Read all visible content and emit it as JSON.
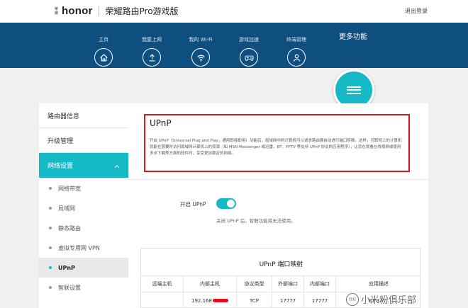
{
  "header": {
    "brand_small": "荣耀",
    "brand": "honor",
    "product": "荣耀路由Pro游戏版",
    "logout": "退出登录"
  },
  "nav": {
    "items": [
      {
        "label": "主页",
        "icon": "home-icon"
      },
      {
        "label": "我要上网",
        "icon": "upload-icon"
      },
      {
        "label": "我的 Wi-Fi",
        "icon": "wifi-icon"
      },
      {
        "label": "游戏加速",
        "icon": "gamepad-icon"
      },
      {
        "label": "终端管理",
        "icon": "user-icon"
      }
    ],
    "more": {
      "label": "更多功能",
      "icon": "menu-icon"
    }
  },
  "sidebar": {
    "items": [
      {
        "label": "路由器信息"
      },
      {
        "label": "升级管理"
      },
      {
        "label": "网络设置"
      }
    ],
    "sub_items": [
      {
        "label": "网络带宽"
      },
      {
        "label": "局域网"
      },
      {
        "label": "静态路由"
      },
      {
        "label": "虚拟专用网 VPN"
      },
      {
        "label": "UPnP"
      },
      {
        "label": "智联设置"
      }
    ]
  },
  "upnp": {
    "title": "UPnP",
    "description": "开启 UPnP（Universal Plug and Play，通用即插即用）功能后，局域网中的计算机可以请求路由器自动进行端口转换。这样，互联网上的计算机就能在需要时访问局域网计算机上的资源（如 MSN Messenger 或迅雷、BT、PPTV 等支持 UPnP 协议的应用程序），让您在观看在线视频或使用多点下载等方面的软件时，享受更加稳定的网络。",
    "toggle_label": "开启 UPnP",
    "toggle_on": true,
    "toggle_hint": "关闭 UPnP 后，智联功能将无法使用。"
  },
  "port_map": {
    "title": "UPnP 端口映射",
    "columns": [
      "远端主机",
      "内部主机",
      "协议类型",
      "外部端口",
      "内部端口",
      "应用描述"
    ],
    "rows": [
      [
        "",
        "192.168",
        "TCP",
        "17777",
        "17777",
        "BT 3.7..."
      ]
    ]
  },
  "watermark": {
    "text": "小米粉俱乐部"
  },
  "colors": {
    "accent": "#16b9c6",
    "nav_bg": "#0e4f7f",
    "highlight_border": "#d9141b"
  }
}
